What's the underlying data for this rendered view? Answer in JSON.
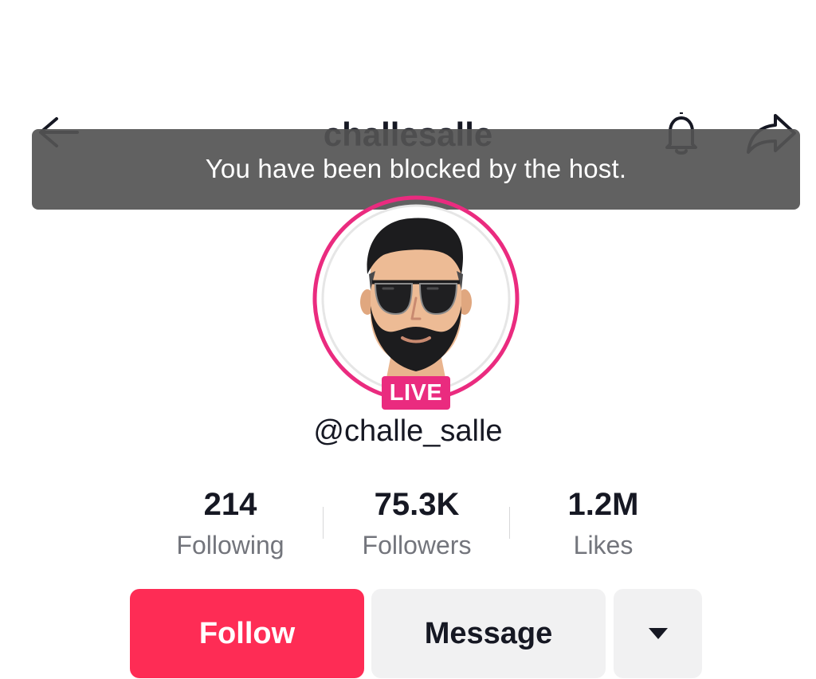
{
  "header": {
    "title": "challesalle",
    "back_icon": "arrow-left-icon",
    "bell_icon": "bell-icon",
    "share_icon": "share-arrow-icon"
  },
  "toast": {
    "message": "You have been blocked by the host."
  },
  "profile": {
    "avatar_icon": "avatar-cartoon-man-sunglasses",
    "live_badge": "LIVE",
    "username": "@challe_salle",
    "ring_color": "#ea2b7f"
  },
  "stats": [
    {
      "value": "214",
      "label": "Following"
    },
    {
      "value": "75.3K",
      "label": "Followers"
    },
    {
      "value": "1.2M",
      "label": "Likes"
    }
  ],
  "actions": {
    "follow_label": "Follow",
    "message_label": "Message",
    "more_icon": "caret-down-icon"
  },
  "colors": {
    "accent": "#fe2c55",
    "live": "#ea2b7f",
    "text": "#161823",
    "muted": "#73757c",
    "button_gray": "#f1f1f2",
    "toast_bg": "#545454"
  }
}
